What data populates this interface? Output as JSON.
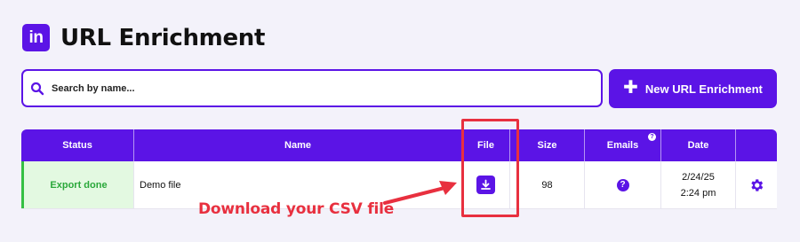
{
  "header": {
    "logo_text": "in",
    "title": "URL Enrichment"
  },
  "search": {
    "placeholder": "Search by name..."
  },
  "new_button": {
    "icon": "plus-icon",
    "label": "New URL Enrichment"
  },
  "table": {
    "columns": [
      "Status",
      "Name",
      "File",
      "Size",
      "Emails",
      "Date",
      ""
    ],
    "emails_info_icon": "?",
    "rows": [
      {
        "status": "Export done",
        "name": "Demo file",
        "file_icon": "download-icon",
        "size": "98",
        "emails_icon": "?",
        "date_line1": "2/24/25",
        "date_line2": "2:24 pm",
        "settings_icon": "gear-icon"
      }
    ]
  },
  "annotation": {
    "text": "Download your CSV file"
  },
  "colors": {
    "brand": "#5b14e6",
    "background": "#f3f2fa",
    "status_bg": "#e3f9e1",
    "status_text": "#2aa83a",
    "annotation": "#e8303f"
  }
}
